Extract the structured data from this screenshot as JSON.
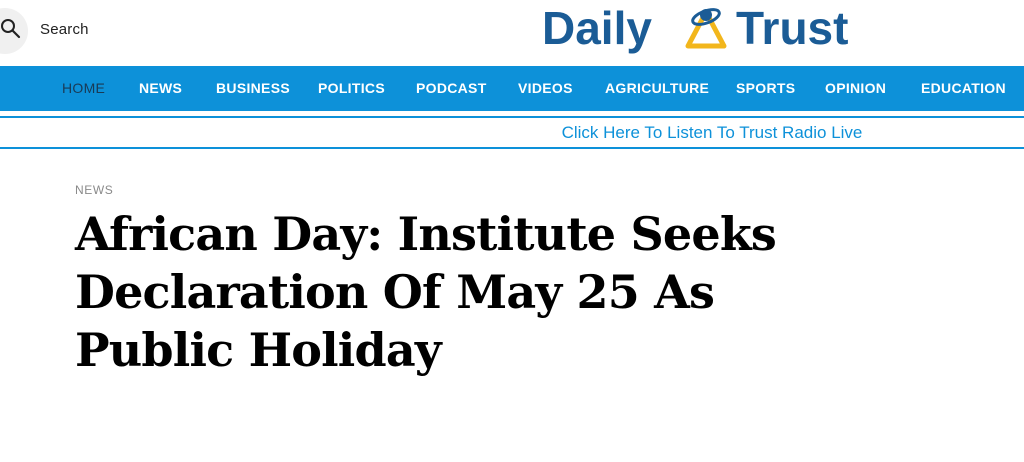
{
  "header": {
    "search_label": "Search",
    "logo_word_1": "Daily",
    "logo_word_2": "Trust",
    "brand_color": "#1b5c96",
    "logo_accent_color": "#f2b61c"
  },
  "nav": {
    "bar_color": "#0d91d9",
    "items": [
      {
        "label": "HOME",
        "active": true
      },
      {
        "label": "NEWS"
      },
      {
        "label": "BUSINESS"
      },
      {
        "label": "POLITICS"
      },
      {
        "label": "PODCAST"
      },
      {
        "label": "VIDEOS"
      },
      {
        "label": "AGRICULTURE"
      },
      {
        "label": "SPORTS"
      },
      {
        "label": "OPINION"
      },
      {
        "label": "EDUCATION"
      }
    ]
  },
  "radio": {
    "link_text": "Click Here To Listen To Trust Radio Live"
  },
  "article": {
    "category": "NEWS",
    "headline": "African Day: Institute Seeks Declaration Of May 25 As Public Holiday"
  }
}
